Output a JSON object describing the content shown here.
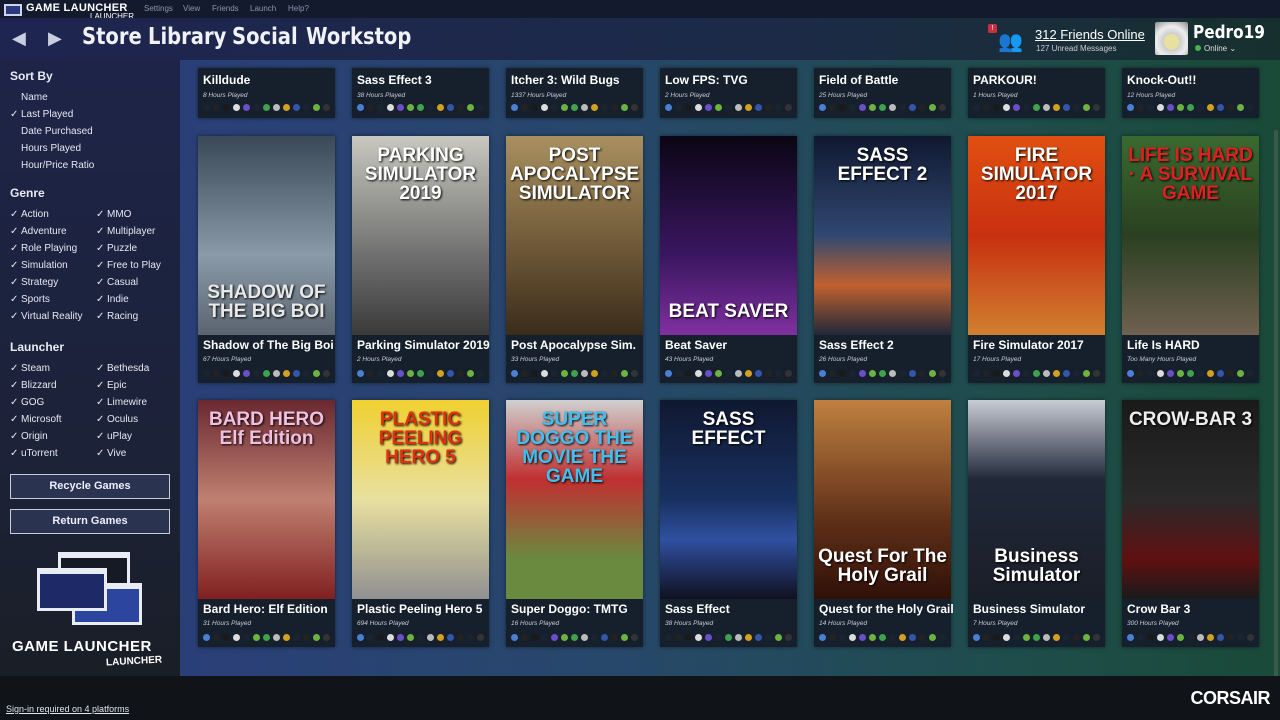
{
  "app": {
    "title": "GAME LAUNCHER",
    "subtitle": "LAUNCHER"
  },
  "menu": [
    "Settings",
    "View",
    "Friends",
    "Launch",
    "Help?"
  ],
  "nav": {
    "back": "◀",
    "forward": "▶",
    "tabs": [
      "Store",
      "Library",
      "Social",
      "Workstop"
    ]
  },
  "social": {
    "alert": "!",
    "friends_online": "312 Friends Online",
    "unread": "127 Unread Messages"
  },
  "user": {
    "name": "Pedro19",
    "status": "Online ⌄"
  },
  "sidebar": {
    "sort_title": "Sort By",
    "sort": [
      {
        "label": "Name",
        "checked": false
      },
      {
        "label": "Last Played",
        "checked": true
      },
      {
        "label": "Date Purchased",
        "checked": false
      },
      {
        "label": "Hours Played",
        "checked": false
      },
      {
        "label": "Hour/Price Ratio",
        "checked": false
      }
    ],
    "genre_title": "Genre",
    "genre": [
      "Action",
      "MMO",
      "Adventure",
      "Multiplayer",
      "Role Playing",
      "Puzzle",
      "Simulation",
      "Free to Play",
      "Strategy",
      "Casual",
      "Sports",
      "Indie",
      "Virtual Reality",
      "Racing"
    ],
    "launcher_title": "Launcher",
    "launchers": [
      "Steam",
      "Bethesda",
      "Blizzard",
      "Epic",
      "GOG",
      "Limewire",
      "Microsoft",
      "Oculus",
      "Origin",
      "uPlay",
      "uTorrent",
      "Vive"
    ],
    "check": "✓",
    "recycle": "Recycle Games",
    "return": "Return Games"
  },
  "footer": {
    "signin": "Sign-in required on 4 platforms",
    "brand": "CORSAIR"
  },
  "platform_colors": [
    "#4a7fd4",
    "#222",
    "#1a1a1a",
    "#ddd",
    "#6a4fc8",
    "#6cb33f",
    "#3ea34a",
    "#bbb",
    "#d4a020",
    "#3355aa",
    "#222",
    "#6cb33f",
    "#333"
  ],
  "games_top": [
    {
      "title": "Killdude",
      "hours": "8 Hours Played"
    },
    {
      "title": "Sass Effect 3",
      "hours": "38 Hours Played"
    },
    {
      "title": "Itcher 3: Wild Bugs",
      "hours": "1337 Hours Played"
    },
    {
      "title": "Low FPS: TVG",
      "hours": "2 Hours Played"
    },
    {
      "title": "Field of Battle",
      "hours": "25 Hours Played"
    },
    {
      "title": "PARKOUR!",
      "hours": "1 Hours Played"
    },
    {
      "title": "Knock-Out!!",
      "hours": "12 Hours Played"
    }
  ],
  "games": [
    {
      "title": "Shadow of The Big Boi",
      "hours": "67 Hours Played",
      "cover_text": "SHADOW OF THE BIG BOI",
      "bg": "linear-gradient(180deg,#3a4858,#8a9aa8 60%,#5a6470)",
      "pos": "bottom",
      "color": "#e8e8e8"
    },
    {
      "title": "Parking Simulator 2019",
      "hours": "2 Hours Played",
      "cover_text": "PARKING SIMULATOR 2019",
      "bg": "linear-gradient(180deg,#c8c8c0,#707070 60%,#3a3a3a)",
      "pos": "top",
      "color": "#fff"
    },
    {
      "title": "Post Apocalypse Sim.",
      "hours": "33 Hours Played",
      "cover_text": "POST APOCALYPSE SIMULATOR",
      "bg": "linear-gradient(180deg,#a89060,#6a5434 60%,#3a2c1c)",
      "pos": "top",
      "color": "#fff"
    },
    {
      "title": "Beat Saver",
      "hours": "43 Hours Played",
      "cover_text": "BEAT SAVER",
      "bg": "linear-gradient(180deg,#0a0614,#3a1660 60%,#8030a0)",
      "pos": "bottom",
      "color": "#fff"
    },
    {
      "title": "Sass Effect 2",
      "hours": "26 Hours Played",
      "cover_text": "SASS EFFECT 2",
      "bg": "linear-gradient(180deg,#101830,#304870 50%,#c06030 75%,#202838)",
      "pos": "top",
      "color": "#fff"
    },
    {
      "title": "Fire Simulator 2017",
      "hours": "17 Hours Played",
      "cover_text": "FIRE SIMULATOR 2017",
      "bg": "linear-gradient(180deg,#e05010,#c83010 50%,#d08030)",
      "pos": "top",
      "color": "#fff"
    },
    {
      "title": "Life Is HARD",
      "hours": "Too Many Hours Played",
      "cover_text": "LIFE IS HARD · A SURVIVAL GAME",
      "bg": "linear-gradient(180deg,#3a6a30,#2a4020 50%,#706050)",
      "pos": "top",
      "color": "#e02020"
    },
    {
      "title": "Bard Hero: Elf Edition",
      "hours": "31 Hours Played",
      "cover_text": "BARD HERO Elf Edition",
      "bg": "linear-gradient(180deg,#6a2830,#c08070 50%,#802020)",
      "pos": "top",
      "color": "#f0c0e0"
    },
    {
      "title": "Plastic Peeling Hero 5",
      "hours": "694 Hours Played",
      "cover_text": "PLASTIC PEELING HERO 5",
      "bg": "linear-gradient(180deg,#f0d030,#e8e0a0 50%,#909090)",
      "pos": "top",
      "color": "#e03010"
    },
    {
      "title": "Super Doggo: TMTG",
      "hours": "16 Hours Played",
      "cover_text": "SUPER DOGGO THE MOVIE THE GAME",
      "bg": "linear-gradient(180deg,#d0d0d0,#c03030 40%,#6a8a40 80%)",
      "pos": "top",
      "color": "#40c0f0"
    },
    {
      "title": "Sass Effect",
      "hours": "38 Hours Played",
      "cover_text": "SASS EFFECT",
      "bg": "linear-gradient(180deg,#101830,#183060 50%,#3050a0 70%,#101020)",
      "pos": "top",
      "color": "#fff"
    },
    {
      "title": "Quest for the Holy Grail",
      "hours": "14 Hours Played",
      "cover_text": "Quest For The Holy Grail",
      "bg": "linear-gradient(180deg,#c08040,#603018 60%,#301008)",
      "pos": "bottom",
      "color": "#fff"
    },
    {
      "title": "Business Simulator",
      "hours": "7 Hours Played",
      "cover_text": "Business Simulator",
      "bg": "linear-gradient(180deg,#c8ccd4,#202838 40%,#1a1e28)",
      "pos": "bottom",
      "color": "#fff"
    },
    {
      "title": "Crow Bar 3",
      "hours": "300 Hours Played",
      "cover_text": "CROW-BAR 3",
      "bg": "linear-gradient(180deg,#1a1a1a,#2a2a2a 50%,#601010 80%,#1a1a1a)",
      "pos": "top",
      "color": "#eee"
    }
  ]
}
